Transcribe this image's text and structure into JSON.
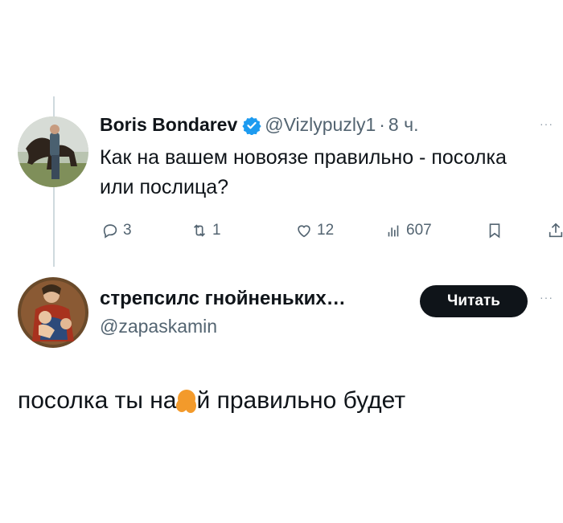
{
  "tweet": {
    "author_name": "Boris Bondarev",
    "handle": "@Vizlypuzly1",
    "separator": "·",
    "time": "8 ч.",
    "more": "···",
    "text": "Как на вашем новоязе правильно - посолка или послица?",
    "stats": {
      "replies": "3",
      "retweets": "1",
      "likes": "12",
      "views": "607"
    }
  },
  "reply_card": {
    "author_name": "стрепсилс гнойненьких…",
    "handle": "@zapaskamin",
    "follow_label": "Читать",
    "more": "···"
  },
  "caption": {
    "before": "посолка ты на",
    "after": "й правильно будет"
  },
  "colors": {
    "text": "#0f1419",
    "secondary": "#536471",
    "verified": "#1d9bf0",
    "follow_bg": "#0f1419",
    "censor_blob": "#f39a2b"
  }
}
